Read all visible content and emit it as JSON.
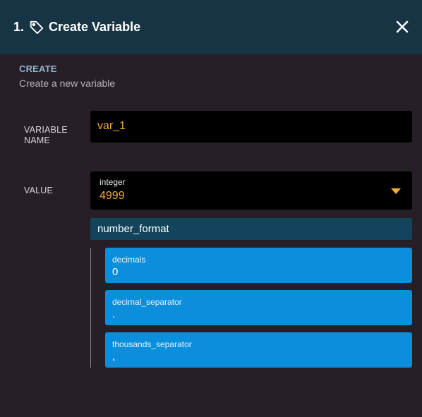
{
  "header": {
    "step": "1.",
    "title": "Create Variable"
  },
  "section": {
    "title": "CREATE",
    "subtitle": "Create a new variable"
  },
  "variable_name": {
    "label": "VARIABLE NAME",
    "value": "var_1"
  },
  "value": {
    "label": "VALUE",
    "type": "integer",
    "value": "4999"
  },
  "number_format": {
    "title": "number_format",
    "fields": [
      {
        "name": "decimals",
        "value": "0"
      },
      {
        "name": "decimal_separator",
        "value": "."
      },
      {
        "name": "thousands_separator",
        "value": ","
      }
    ]
  },
  "icons": {
    "tag": "tag-icon",
    "close": "close-icon",
    "dropdown": "caret-down-icon"
  },
  "colors": {
    "header_bg": "#173445",
    "panel_bg": "#271f27",
    "value_text": "#f2ad3a",
    "field_bg": "#0b8edb",
    "group_header_bg": "#13445b"
  }
}
